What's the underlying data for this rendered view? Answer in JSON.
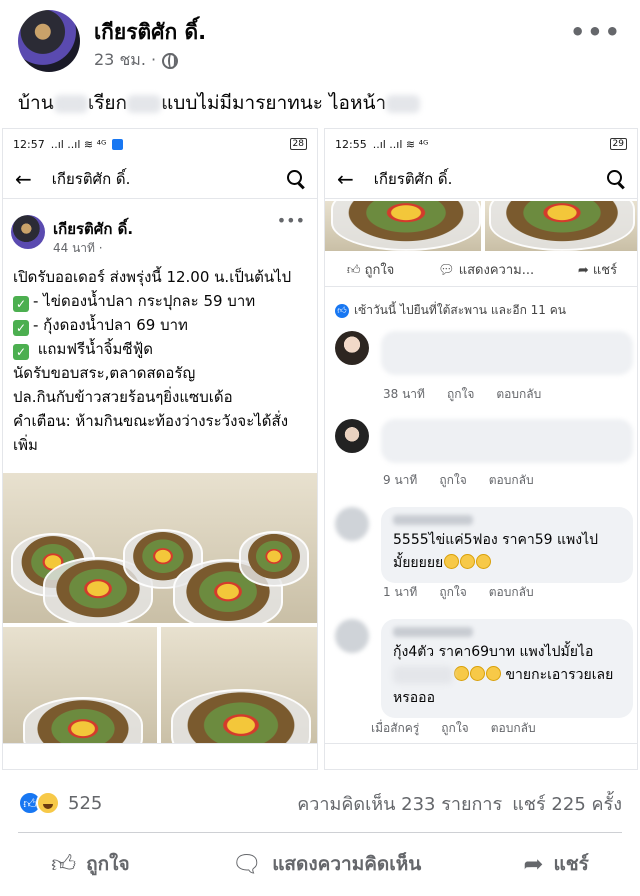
{
  "post": {
    "author": "เกียรติศัก ดิ์.",
    "time": "23 ชม. ·",
    "more": "•••",
    "caption_a": "บ้าน",
    "caption_b": "เรียก",
    "caption_c": "แบบไม่มีมารยาทนะ ไอหน้า"
  },
  "left_pane": {
    "status_time": "12:57",
    "status_signal": "..ıl ..ıl ≋ ⁴ᴳ",
    "battery": "28",
    "nav_title": "เกียรติศัก ดิ์.",
    "author": "เกียรติศัก ดิ์.",
    "time": "44 นาที ·",
    "more": "•••",
    "lines": [
      "เปิดรับออเดอร์ ส่งพรุ่งนี้ 12.00 น.เป็นต้นไป",
      "- ไข่ดองน้ำปลา กระปุกละ  59 บาท",
      "- กุ้งดองน้ำปลา 69 บาท",
      " แถมฟรีน้ำจิ้มซีฟู้ด",
      "นัดรับขอบสระ,ตลาดสดอรัญ",
      "ปล.กินกับข้าวสวยร้อนๆยิ่งแซบเด้อ",
      "คำเตือน: ห้ามกินขณะท้องว่างระวังจะได้สั่ง",
      "เพิ่ม"
    ]
  },
  "right_pane": {
    "status_time": "12:55",
    "status_signal": "..ıl ..ıl ≋ ⁴ᴳ",
    "battery": "29",
    "nav_title": "เกียรติศัก ดิ์.",
    "actions": [
      "ถูกใจ",
      "แสดงความ...",
      "แชร์"
    ],
    "likes_text": "เซ้าวันนี้ ไปยืนที่ใต้สะพาน และอีก 11 คน",
    "comments": [
      {
        "time": "38 นาที",
        "like": "ถูกใจ",
        "reply": "ตอบกลับ"
      },
      {
        "time": "9 นาที",
        "like": "ถูกใจ",
        "reply": "ตอบกลับ"
      },
      {
        "text1": "5555ไข่แค่5ฟอง ราคา59 แพงไป",
        "text2": "มั้ยยยยย",
        "time": "1 นาที",
        "like": "ถูกใจ",
        "reply": "ตอบกลับ"
      },
      {
        "text1": "กุ้ง4ตัว ราคา69บาท แพงไปมั้ยไอ",
        "text2": "ขายกะเอารวยเลย",
        "text3": "หรอออ",
        "time": "เมื่อสักครู่",
        "like": "ถูกใจ",
        "reply": "ตอบกลับ"
      }
    ]
  },
  "stats": {
    "reactions_count": "525",
    "comments_count": "ความคิดเห็น 233 รายการ",
    "shares_count": "แชร์ 225 ครั้ง"
  },
  "actions": {
    "like": "ถูกใจ",
    "comment": "แสดงความคิดเห็น",
    "share": "แชร์"
  }
}
